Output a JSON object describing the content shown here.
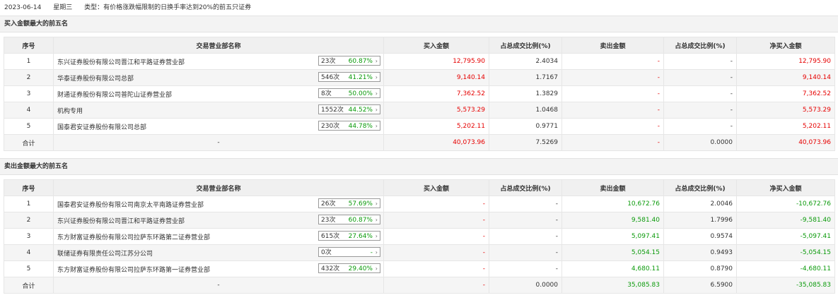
{
  "header": {
    "date": "2023-06-14",
    "weekday": "星期三",
    "type_text": "类型：有价格涨跌幅限制的日换手率达到20%的前五只证券"
  },
  "columns": [
    "序号",
    "交易营业部名称",
    "买入金额",
    "占总成交比例(%)",
    "卖出金额",
    "占总成交比例(%)",
    "净买入金额"
  ],
  "buy": {
    "title": "买入金额最大的前五名",
    "rows": [
      {
        "idx": "1",
        "name": "东兴证券股份有限公司晋江和平路证券营业部",
        "times": "23次",
        "pct": "60.87%",
        "buy": "12,795.90",
        "buy_ratio": "2.4034",
        "sell": "-",
        "sell_ratio": "-",
        "net": "12,795.90"
      },
      {
        "idx": "2",
        "name": "华泰证券股份有限公司总部",
        "times": "546次",
        "pct": "41.21%",
        "buy": "9,140.14",
        "buy_ratio": "1.7167",
        "sell": "-",
        "sell_ratio": "-",
        "net": "9,140.14"
      },
      {
        "idx": "3",
        "name": "财通证券股份有限公司普陀山证券营业部",
        "times": "8次",
        "pct": "50.00%",
        "buy": "7,362.52",
        "buy_ratio": "1.3829",
        "sell": "-",
        "sell_ratio": "-",
        "net": "7,362.52"
      },
      {
        "idx": "4",
        "name": "机构专用",
        "times": "1552次",
        "pct": "44.52%",
        "buy": "5,573.29",
        "buy_ratio": "1.0468",
        "sell": "-",
        "sell_ratio": "-",
        "net": "5,573.29"
      },
      {
        "idx": "5",
        "name": "国泰君安证券股份有限公司总部",
        "times": "230次",
        "pct": "44.78%",
        "buy": "5,202.11",
        "buy_ratio": "0.9771",
        "sell": "-",
        "sell_ratio": "-",
        "net": "5,202.11"
      }
    ],
    "total": {
      "label": "合计",
      "name": "-",
      "buy": "40,073.96",
      "buy_ratio": "7.5269",
      "sell": "-",
      "sell_ratio": "0.0000",
      "net": "40,073.96"
    }
  },
  "sell": {
    "title": "卖出金额最大的前五名",
    "rows": [
      {
        "idx": "1",
        "name": "国泰君安证券股份有限公司南京太平南路证券营业部",
        "times": "26次",
        "pct": "57.69%",
        "buy": "-",
        "buy_ratio": "-",
        "sell": "10,672.76",
        "sell_ratio": "2.0046",
        "net": "-10,672.76"
      },
      {
        "idx": "2",
        "name": "东兴证券股份有限公司晋江和平路证券营业部",
        "times": "23次",
        "pct": "60.87%",
        "buy": "-",
        "buy_ratio": "-",
        "sell": "9,581.40",
        "sell_ratio": "1.7996",
        "net": "-9,581.40"
      },
      {
        "idx": "3",
        "name": "东方财富证券股份有限公司拉萨东环路第二证券营业部",
        "times": "615次",
        "pct": "27.64%",
        "buy": "-",
        "buy_ratio": "-",
        "sell": "5,097.41",
        "sell_ratio": "0.9574",
        "net": "-5,097.41"
      },
      {
        "idx": "4",
        "name": "联储证券有限责任公司江苏分公司",
        "times": "0次",
        "pct": "-",
        "buy": "-",
        "buy_ratio": "-",
        "sell": "5,054.15",
        "sell_ratio": "0.9493",
        "net": "-5,054.15"
      },
      {
        "idx": "5",
        "name": "东方财富证券股份有限公司拉萨东环路第一证券营业部",
        "times": "432次",
        "pct": "29.40%",
        "buy": "-",
        "buy_ratio": "-",
        "sell": "4,680.11",
        "sell_ratio": "0.8790",
        "net": "-4,680.11"
      }
    ],
    "total": {
      "label": "合计",
      "name": "-",
      "buy": "-",
      "buy_ratio": "0.0000",
      "sell": "35,085.83",
      "sell_ratio": "6.5900",
      "net": "-35,085.83"
    }
  },
  "colors": {
    "buy_red": "#e60000",
    "sell_green": "#0a9a0a"
  },
  "icons": {
    "badge_arrow": "chevron-right-icon"
  }
}
